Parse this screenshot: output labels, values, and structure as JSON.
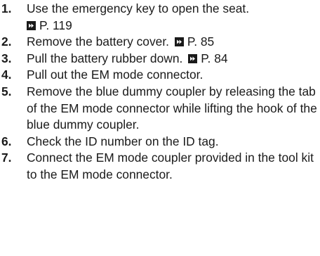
{
  "steps": [
    {
      "number": "1.",
      "text": "Use the emergency key to open the seat.",
      "ref": "P. 119",
      "ref_break": true
    },
    {
      "number": "2.",
      "text": "Remove the battery cover.",
      "ref": "P. 85"
    },
    {
      "number": "3.",
      "text": "Pull the battery rubber down.",
      "ref": "P. 84"
    },
    {
      "number": "4.",
      "text": "Pull out the EM mode connector."
    },
    {
      "number": "5.",
      "text": "Remove the blue dummy coupler by releasing the tab of the EM mode connector while lifting the hook of the blue dummy coupler."
    },
    {
      "number": "6.",
      "text": "Check the ID number on the ID tag."
    },
    {
      "number": "7.",
      "text": "Connect the EM mode coupler provided in the tool kit to the EM mode connector."
    }
  ],
  "icons": {
    "reference": "page-reference-arrow-icon"
  }
}
